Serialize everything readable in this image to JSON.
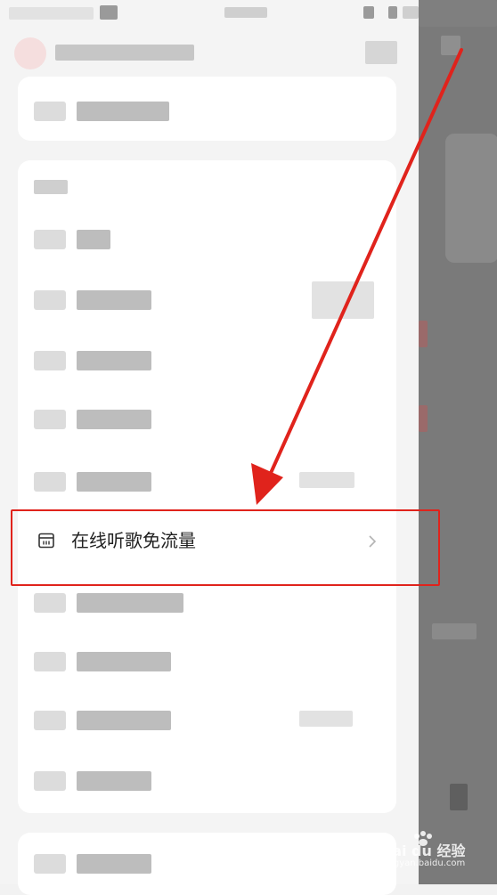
{
  "highlight_item": {
    "label": "在线听歌免流量"
  },
  "watermark": {
    "brand": "Bai du 经验",
    "sub": "jingyan.baidu.com"
  },
  "colors": {
    "annotation_red": "#e0231c",
    "drawer_background": "#f4f4f4",
    "card_background": "#ffffff",
    "dim_overlay": "#7a7a7a"
  }
}
